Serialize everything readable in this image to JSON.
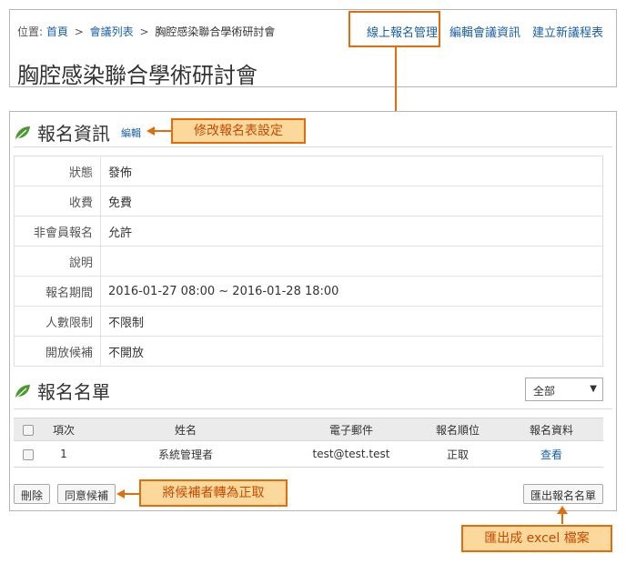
{
  "breadcrumb": {
    "label": "位置:",
    "home": "首頁",
    "sep1": ">",
    "list": "會議列表",
    "sep2": ">",
    "current": "胸腔感染聯合學術研討會"
  },
  "top_nav": {
    "online_registration": "線上報名管理",
    "edit_meeting": "編輯會議資訊",
    "new_agenda": "建立新議程表"
  },
  "page_title": "胸腔感染聯合學術研討會",
  "registration_info": {
    "title": "報名資訊",
    "edit_link": "編輯",
    "rows": [
      {
        "label": "狀態",
        "value": "發佈"
      },
      {
        "label": "收費",
        "value": "免費"
      },
      {
        "label": "非會員報名",
        "value": "允許"
      },
      {
        "label": "說明",
        "value": ""
      },
      {
        "label": "報名期間",
        "value": "2016-01-27 08:00 ~ 2016-01-28 18:00"
      },
      {
        "label": "人數限制",
        "value": "不限制"
      },
      {
        "label": "開放候補",
        "value": "不開放"
      }
    ]
  },
  "registration_list": {
    "title": "報名名單",
    "filter_selected": "全部",
    "columns": [
      "項次",
      "姓名",
      "電子郵件",
      "報名順位",
      "報名資料"
    ],
    "rows": [
      {
        "index": "1",
        "name": "系統管理者",
        "email": "test@test.test",
        "order": "正取",
        "action": "查看"
      }
    ]
  },
  "buttons": {
    "delete": "刪除",
    "approve_waitlist": "同意候補",
    "export": "匯出報名名單"
  },
  "callouts": {
    "edit_form": "修改報名表設定",
    "waitlist": "將候補者轉為正取",
    "excel": "匯出成 excel 檔案"
  },
  "colors": {
    "accent": "#e46c0a",
    "callout_fill": "#fbd89b",
    "link": "#1a5fa8",
    "leaf": "#4a9a2f"
  },
  "icons": {
    "section": "leaf-icon",
    "dropdown": "chevron-down-icon"
  }
}
